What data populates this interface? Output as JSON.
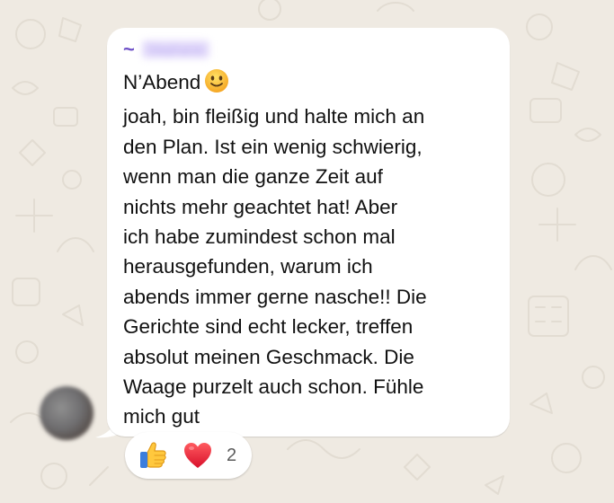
{
  "message": {
    "sender_prefix": "~",
    "sender_name": "Stephanie",
    "greeting": "N’Abend",
    "greeting_emoji": "slightly-smiling-face",
    "body": "joah, bin fleißig und halte mich an\nden Plan. Ist ein wenig schwierig,\nwenn man die ganze Zeit auf\nnichts mehr geachtet hat! Aber\nich habe zumindest schon mal\nherausgefunden, warum ich\nabends immer gerne nasche!! Die\nGerichte sind echt lecker, treffen\nabsolut meinen Geschmack. Die\nWaage purzelt auch schon. Fühle\nmich gut"
  },
  "reactions": {
    "emojis": [
      "thumbs-up",
      "red-heart"
    ],
    "count": "2"
  },
  "colors": {
    "chat_background": "#efeae2",
    "bubble": "#ffffff",
    "sender_accent": "#6d4fc7",
    "text": "#111111"
  }
}
